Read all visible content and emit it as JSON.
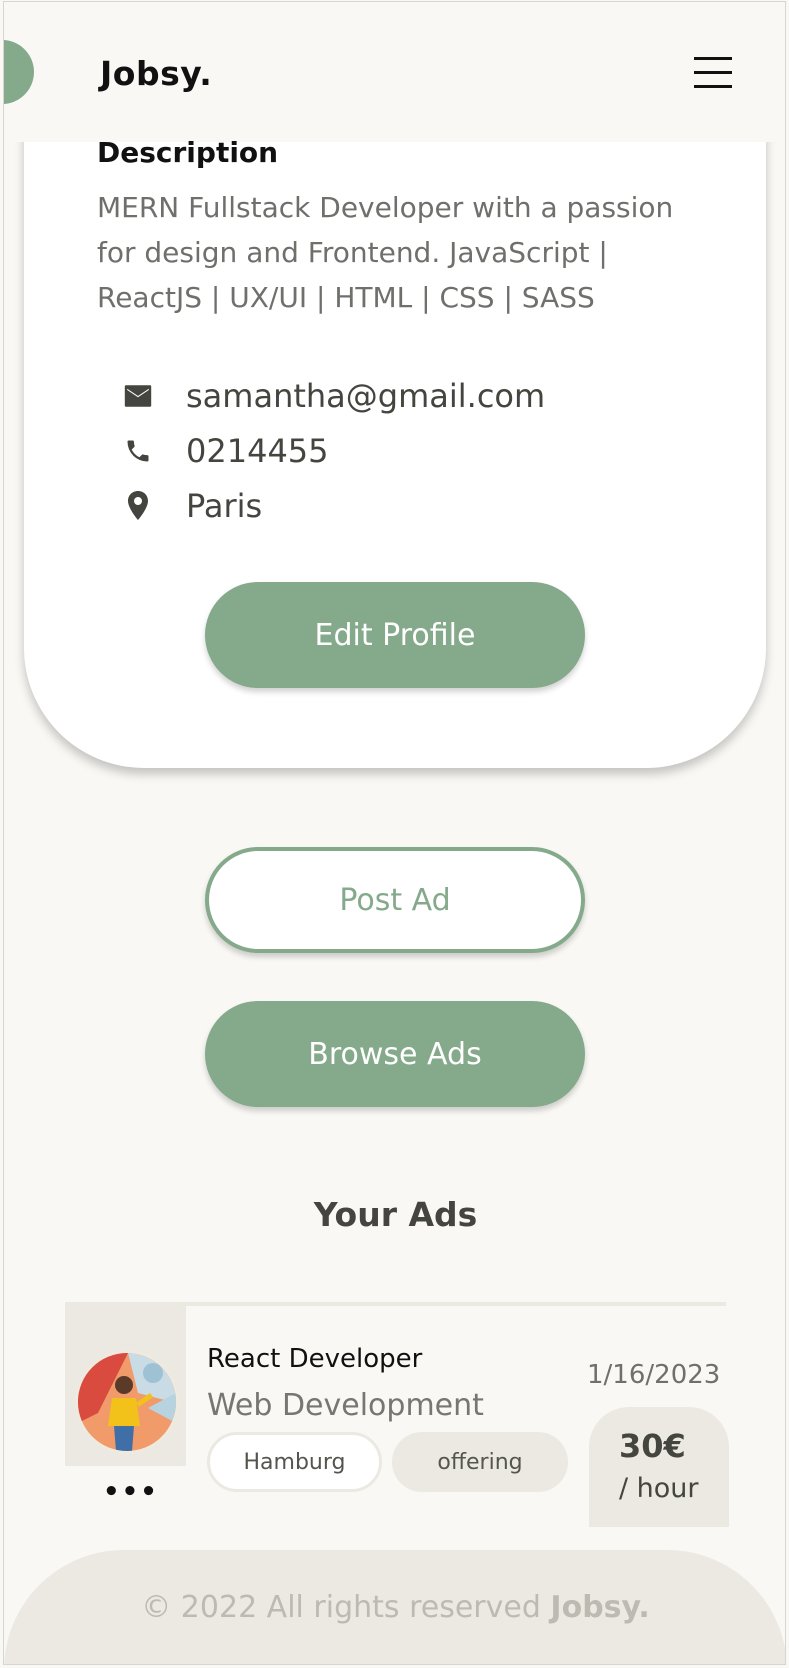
{
  "header": {
    "brand": "Jobsy.",
    "menu_icon": "hamburger-menu-icon"
  },
  "profile": {
    "description_title": "Description",
    "description": "MERN Fullstack Developer with a passion for design and Frontend. JavaScript | ReactJS | UX/UI | HTML | CSS | SASS",
    "email": "samantha@gmail.com",
    "phone": "0214455",
    "location": "Paris",
    "edit_label": "Edit Profile"
  },
  "actions": {
    "post_ad": "Post Ad",
    "browse_ads": "Browse Ads"
  },
  "your_ads": {
    "title": "Your Ads",
    "items": [
      {
        "title": "React Developer",
        "category": "Web Development",
        "location": "Hamburg",
        "type": "offering",
        "date": "1/16/2023",
        "price": "30€",
        "unit": "/ hour",
        "more": "•••"
      }
    ]
  },
  "footer": {
    "text": "© 2022 All rights reserved ",
    "brand": "Jobsy."
  },
  "colors": {
    "accent": "#85a98b",
    "background": "#f9f8f4",
    "chip": "#ece9e2"
  }
}
